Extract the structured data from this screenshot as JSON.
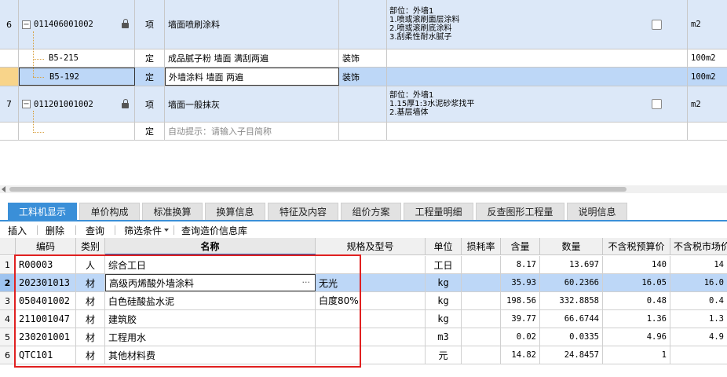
{
  "upper_rows": [
    {
      "index": "6",
      "code": "011406001002",
      "type": "项",
      "name": "墙面喷刷涂料",
      "category": "",
      "desc": [
        "部位：外墙1",
        "1.喷或滚刷面层涂料",
        "2.喷或滚刷底涂料",
        "3.刮柔性耐水腻子"
      ],
      "unit": "m2"
    },
    {
      "index": "",
      "code": "B5-215",
      "type": "定",
      "name": "成品腻子粉 墙面 满刮两遍",
      "category": "装饰",
      "desc": [],
      "unit": "100m2"
    },
    {
      "index": "",
      "code": "B5-192",
      "type": "定",
      "name": "外墙涂料 墙面 两遍",
      "category": "装饰",
      "desc": [],
      "unit": "100m2"
    },
    {
      "index": "7",
      "code": "011201001002",
      "type": "项",
      "name": "墙面一般抹灰",
      "category": "",
      "desc": [
        "部位：外墙1",
        "1.15厚1:3水泥砂浆找平",
        "2.基层墙体"
      ],
      "unit": "m2"
    },
    {
      "index": "",
      "code": "",
      "type": "定",
      "name": "自动提示：请输入子目简称",
      "category": "",
      "desc": [],
      "unit": ""
    }
  ],
  "tabs": [
    "工料机显示",
    "单价构成",
    "标准换算",
    "换算信息",
    "特征及内容",
    "组价方案",
    "工程量明细",
    "反查图形工程量",
    "说明信息"
  ],
  "toolbar": {
    "insert": "插入",
    "delete": "删除",
    "query": "查询",
    "filter": "筛选条件",
    "query_price": "查询造价信息库"
  },
  "lower_headers": [
    "编码",
    "类别",
    "名称",
    "规格及型号",
    "单位",
    "损耗率",
    "含量",
    "数量",
    "不含税预算价",
    "不含税市场价"
  ],
  "lower_rows": [
    {
      "idx": "1",
      "code": "R00003",
      "cat": "人",
      "name": "综合工日",
      "spec": "",
      "unit": "工日",
      "loss": "",
      "content": "8.17",
      "qty": "13.697",
      "budget": "140",
      "market": "14"
    },
    {
      "idx": "2",
      "code": "202301013",
      "cat": "材",
      "name": "高级丙烯酸外墙涂料",
      "spec": "无光",
      "unit": "kg",
      "loss": "",
      "content": "35.93",
      "qty": "60.2366",
      "budget": "16.05",
      "market": "16.0"
    },
    {
      "idx": "3",
      "code": "050401002",
      "cat": "材",
      "name": "白色硅酸盐水泥",
      "spec": "白度80%",
      "unit": "kg",
      "loss": "",
      "content": "198.56",
      "qty": "332.8858",
      "budget": "0.48",
      "market": "0.4"
    },
    {
      "idx": "4",
      "code": "211001047",
      "cat": "材",
      "name": "建筑胶",
      "spec": "",
      "unit": "kg",
      "loss": "",
      "content": "39.77",
      "qty": "66.6744",
      "budget": "1.36",
      "market": "1.3"
    },
    {
      "idx": "5",
      "code": "230201001",
      "cat": "材",
      "name": "工程用水",
      "spec": "",
      "unit": "m3",
      "loss": "",
      "content": "0.02",
      "qty": "0.0335",
      "budget": "4.96",
      "market": "4.9"
    },
    {
      "idx": "6",
      "code": "QTC101",
      "cat": "材",
      "name": "其他材料费",
      "spec": "",
      "unit": "元",
      "loss": "",
      "content": "14.82",
      "qty": "24.8457",
      "budget": "1",
      "market": ""
    }
  ],
  "colors": {
    "accent": "#3a8fd8",
    "row_blue": "#dce8f8",
    "row_selected": "#bdd7f7",
    "annotation_red": "#e02020"
  }
}
